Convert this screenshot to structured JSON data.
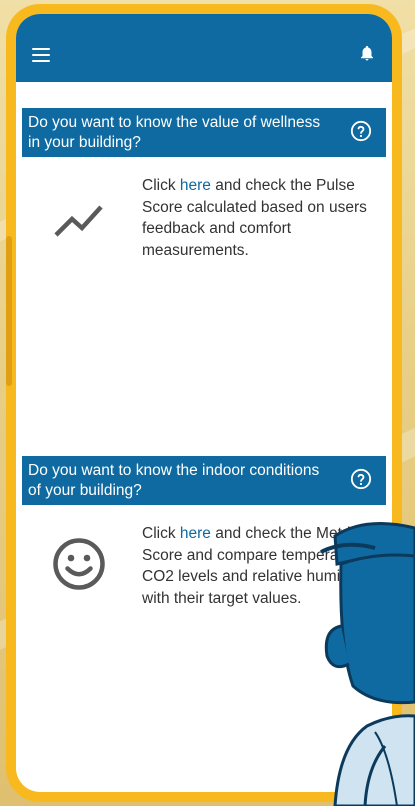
{
  "colors": {
    "primary": "#0e6aa0",
    "link": "#0e6aa0",
    "frame": "#f7b91e",
    "text": "#333333",
    "icon": "#5a5a5a"
  },
  "appbar": {
    "menu_icon": "hamburger-menu-icon",
    "notification_icon": "bell-icon"
  },
  "cards": [
    {
      "question": "Do you want to know the value of wellness in your building?",
      "help_icon": "question-circle-icon",
      "icon": "trending-up-icon",
      "text_before": "Click ",
      "link_text": "here",
      "text_after": " and check the Pulse Score calculated based on users feedback and comfort measurements."
    },
    {
      "question": "Do you want to know the indoor conditions of your building?",
      "help_icon": "question-circle-icon",
      "icon": "smiley-face-icon",
      "text_before": "Click ",
      "link_text": "here",
      "text_after": " and check the Metrix Score and compare temperatures, CO2 levels and relative humidity with their target values."
    }
  ]
}
